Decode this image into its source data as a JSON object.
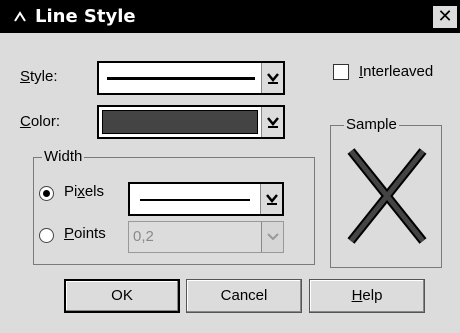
{
  "window": {
    "title": "Line Style",
    "close_glyph": "✕"
  },
  "style": {
    "label_u": "S",
    "label_rest": "tyle:"
  },
  "color": {
    "label_u": "C",
    "label_rest": "olor:",
    "swatch": "#444444"
  },
  "interleaved": {
    "label_u": "I",
    "label_rest": "nterleaved",
    "checked": false
  },
  "sample": {
    "title": "Sample"
  },
  "width": {
    "title": "Width",
    "pixels": {
      "label_a": "Pi",
      "label_u": "x",
      "label_rest": "els",
      "selected": true
    },
    "points": {
      "label_u": "P",
      "label_rest": "oints",
      "value": "0,2",
      "selected": false
    }
  },
  "buttons": {
    "ok": "OK",
    "cancel": "Cancel",
    "help_u": "H",
    "help_rest": "elp"
  },
  "colors": {
    "face": "#dcdcdc",
    "titlebar": "#000000"
  }
}
